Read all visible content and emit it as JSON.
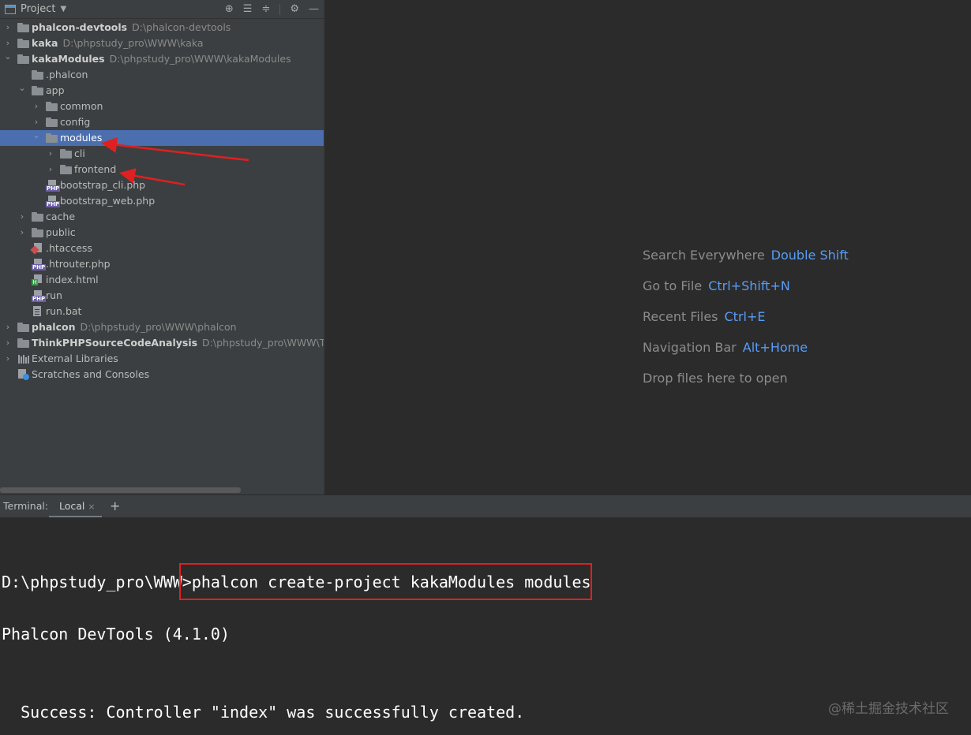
{
  "project_panel": {
    "title": "Project",
    "toolbar_icons": [
      "locate-icon",
      "expand-all-icon",
      "collapse-all-icon",
      "gear-icon",
      "minimize-icon"
    ],
    "tree": [
      {
        "label": "phalcon-devtools",
        "path": "D:\\phalcon-devtools",
        "bold": true,
        "icon": "folder-icon",
        "expanded": false
      },
      {
        "label": "kaka",
        "path": "D:\\phpstudy_pro\\WWW\\kaka",
        "bold": true,
        "icon": "folder-icon",
        "expanded": false
      },
      {
        "label": "kakaModules",
        "path": "D:\\phpstudy_pro\\WWW\\kakaModules",
        "bold": true,
        "icon": "folder-icon",
        "expanded": true
      },
      {
        "label": ".phalcon",
        "icon": "folder-icon"
      },
      {
        "label": "app",
        "icon": "folder-icon",
        "expanded": true
      },
      {
        "label": "common",
        "icon": "folder-icon",
        "expanded": false
      },
      {
        "label": "config",
        "icon": "folder-icon",
        "expanded": false
      },
      {
        "label": "modules",
        "icon": "folder-icon",
        "expanded": true,
        "selected": true
      },
      {
        "label": "cli",
        "icon": "folder-icon",
        "expanded": false
      },
      {
        "label": "frontend",
        "icon": "folder-icon",
        "expanded": false
      },
      {
        "label": "bootstrap_cli.php",
        "icon": "php-file-icon"
      },
      {
        "label": "bootstrap_web.php",
        "icon": "php-file-icon"
      },
      {
        "label": "cache",
        "icon": "folder-icon",
        "expanded": false
      },
      {
        "label": "public",
        "icon": "folder-icon",
        "expanded": false
      },
      {
        "label": ".htaccess",
        "icon": "htaccess-file-icon"
      },
      {
        "label": ".htrouter.php",
        "icon": "php-file-icon"
      },
      {
        "label": "index.html",
        "icon": "html-file-icon"
      },
      {
        "label": "run",
        "icon": "php-file-icon"
      },
      {
        "label": "run.bat",
        "icon": "bat-file-icon"
      },
      {
        "label": "phalcon",
        "path": "D:\\phpstudy_pro\\WWW\\phalcon",
        "bold": true,
        "icon": "folder-icon",
        "expanded": false
      },
      {
        "label": "ThinkPHPSourceCodeAnalysis",
        "path": "D:\\phpstudy_pro\\WWW\\ThinkP",
        "bold": true,
        "icon": "folder-icon",
        "expanded": false
      },
      {
        "label": "External Libraries",
        "icon": "library-icon",
        "expanded": false
      },
      {
        "label": "Scratches and Consoles",
        "icon": "scratches-icon"
      }
    ]
  },
  "editor": {
    "hints": [
      {
        "text": "Search Everywhere",
        "key": "Double Shift"
      },
      {
        "text": "Go to File",
        "key": "Ctrl+Shift+N"
      },
      {
        "text": "Recent Files",
        "key": "Ctrl+E"
      },
      {
        "text": "Navigation Bar",
        "key": "Alt+Home"
      },
      {
        "text": "Drop files here to open",
        "key": ""
      }
    ]
  },
  "terminal": {
    "title": "Terminal:",
    "tab_label": "Local",
    "tab_close": "×",
    "add_tab": "+",
    "lines": [
      "D:\\phpstudy_pro\\WWW>phalcon create-project kakaModules modules",
      "Phalcon DevTools (4.1.0)",
      "  Success: Controller \"index\" was successfully created."
    ]
  },
  "watermark": "@稀土掘金技术社区",
  "colors": {
    "selection": "#4b6eaf",
    "shortcut_key": "#589df6",
    "annotation_red": "#e02020"
  }
}
